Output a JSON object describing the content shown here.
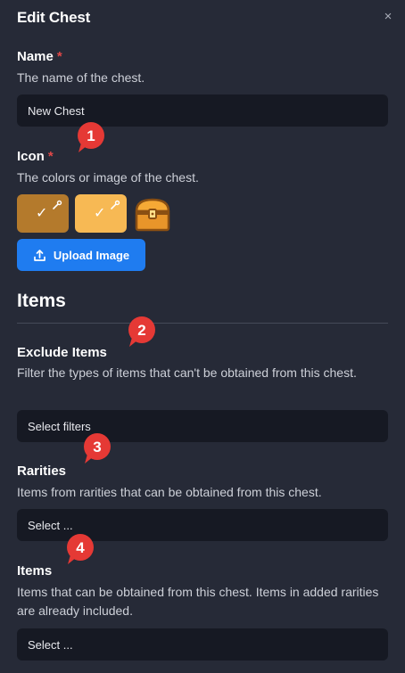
{
  "dialog": {
    "title": "Edit Chest",
    "close_label": "×"
  },
  "name_field": {
    "label": "Name",
    "required_mark": "*",
    "description": "The name of the chest.",
    "value": "New Chest"
  },
  "icon_field": {
    "label": "Icon",
    "required_mark": "*",
    "description": "The colors or image of the chest.",
    "swatches": [
      {
        "color": "#b47a2c",
        "icon": "check-icon",
        "tool": "eyedropper-icon"
      },
      {
        "color": "#f7b954",
        "icon": "check-icon",
        "tool": "eyedropper-icon"
      }
    ],
    "upload_label": "Upload Image"
  },
  "items_section": {
    "title": "Items"
  },
  "exclude_items": {
    "label": "Exclude Items",
    "description": "Filter the types of items that can't be obtained from this chest.",
    "placeholder": "Select filters"
  },
  "rarities": {
    "label": "Rarities",
    "description": "Items from rarities that can be obtained from this chest.",
    "placeholder": "Select ..."
  },
  "items": {
    "label": "Items",
    "description": "Items that can be obtained from this chest. Items in added rarities are already included.",
    "placeholder": "Select ..."
  },
  "annotations": [
    "1",
    "2",
    "3",
    "4"
  ],
  "colors": {
    "background": "#262a37",
    "field": "#161923",
    "accent": "#1f7cf0",
    "required": "#e04848",
    "badge": "#e53935"
  }
}
